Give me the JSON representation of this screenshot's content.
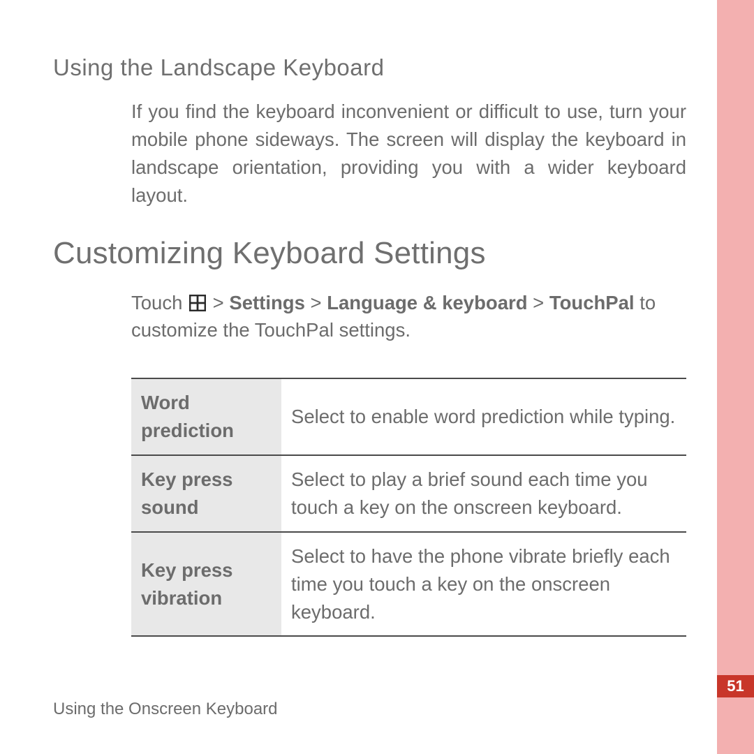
{
  "subheading": "Using  the  Landscape Keyboard",
  "body_para": "If you find the keyboard inconvenient or difficult to use, turn your mobile phone sideways. The screen will display the keyboard in landscape orientation, providing you with a wider keyboard layout.",
  "main_heading": "Customizing Keyboard Settings",
  "intro": {
    "prefix": "Touch ",
    "sep": " > ",
    "path": [
      "Settings",
      "Language & keyboard",
      "TouchPal"
    ],
    "suffix": " to customize the TouchPal settings."
  },
  "table": [
    {
      "label": "Word prediction",
      "desc": "Select to enable word prediction while typing."
    },
    {
      "label": "Key press sound",
      "desc": "Select to play a brief sound each time you touch a key on the onscreen keyboard."
    },
    {
      "label": "Key press vibration",
      "desc": "Select to have the phone vibrate briefly each time you touch a key on the onscreen keyboard."
    }
  ],
  "footer": "Using the Onscreen Keyboard",
  "page_number": "51"
}
